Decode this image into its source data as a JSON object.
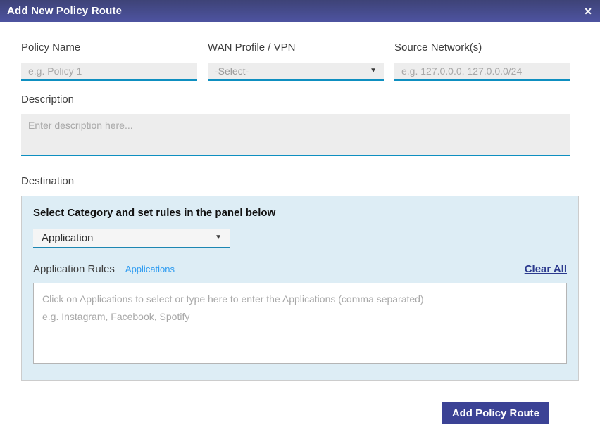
{
  "dialog": {
    "title": "Add New Policy Route"
  },
  "icons": {
    "close": "✕",
    "dropdown_arrow": "▼"
  },
  "form": {
    "policy_name": {
      "label": "Policy Name",
      "placeholder": "e.g. Policy 1"
    },
    "wan_profile": {
      "label": "WAN Profile / VPN",
      "selected_value": "-Select-"
    },
    "source_networks": {
      "label": "Source Network(s)",
      "placeholder": "e.g. 127.0.0.0, 127.0.0.0/24"
    },
    "description": {
      "label": "Description",
      "placeholder": "Enter description here..."
    }
  },
  "destination": {
    "label": "Destination",
    "panel_heading": "Select Category and set rules in the panel below",
    "category": {
      "selected_value": "Application"
    },
    "rules": {
      "label": "Application Rules",
      "applications_link": "Applications",
      "clear_all_link": "Clear All",
      "placeholder_line1": "Click on Applications to select or type here to enter the Applications (comma separated)",
      "placeholder_line2": "e.g. Instagram, Facebook, Spotify"
    }
  },
  "actions": {
    "add_button": "Add Policy Route"
  },
  "colors": {
    "header_gradient_top": "#3e4377",
    "header_gradient_bottom": "#4d53a0",
    "input_underline": "#0e8fc0",
    "panel_background": "#ddedf5",
    "link_blue": "#2e9cf1",
    "clear_all_navy": "#2c3a8e",
    "primary_button": "#3b4295"
  }
}
